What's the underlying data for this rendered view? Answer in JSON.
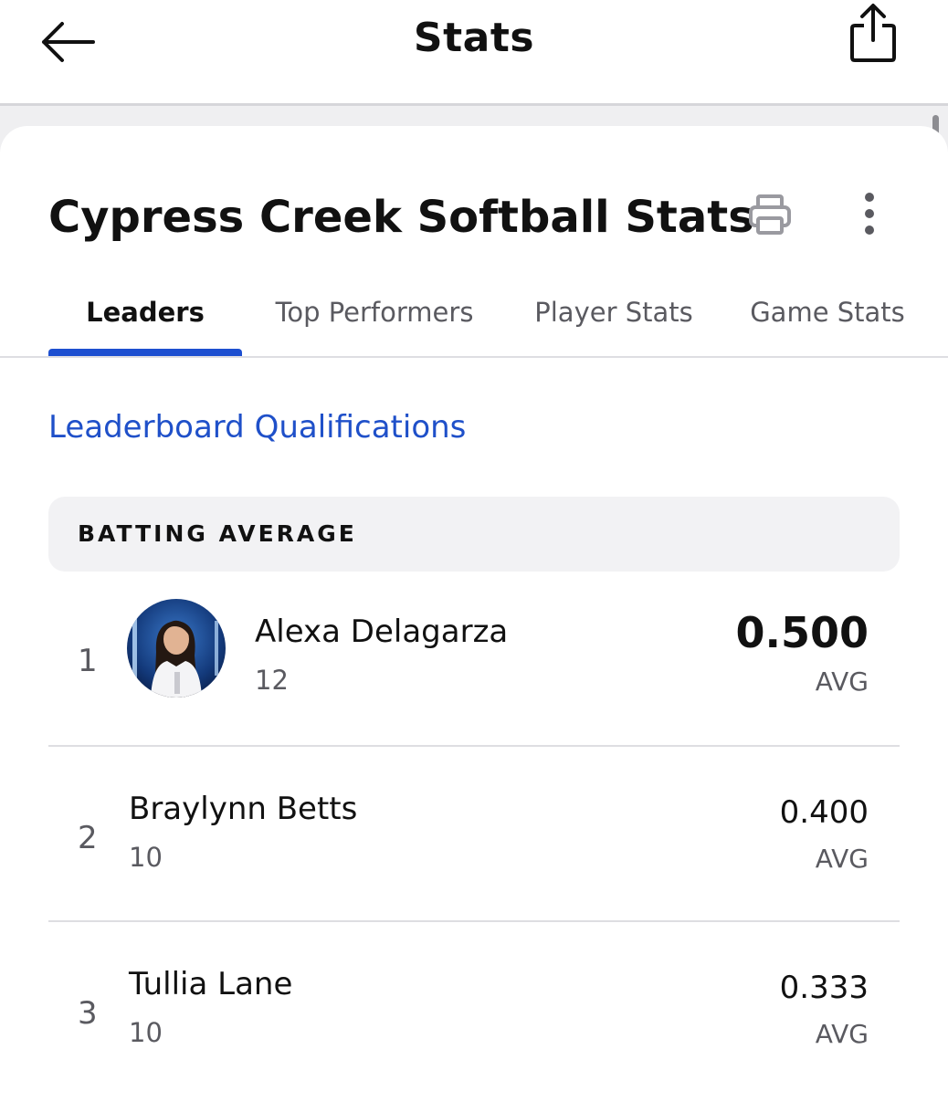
{
  "header": {
    "title": "Stats"
  },
  "card": {
    "title": "Cypress Creek Softball Stats",
    "tabs": [
      {
        "label": "Leaders",
        "active": true
      },
      {
        "label": "Top Performers",
        "active": false
      },
      {
        "label": "Player Stats",
        "active": false
      },
      {
        "label": "Game Stats",
        "active": false
      }
    ],
    "link": "Leaderboard Qualifications"
  },
  "leaderboard": {
    "section_title": "BATTING AVERAGE",
    "rows": [
      {
        "rank": "1",
        "name": "Alexa Delagarza",
        "number": "12",
        "value": "0.500",
        "unit": "AVG"
      },
      {
        "rank": "2",
        "name": "Braylynn Betts",
        "number": "10",
        "value": "0.400",
        "unit": "AVG"
      },
      {
        "rank": "3",
        "name": "Tullia Lane",
        "number": "10",
        "value": "0.333",
        "unit": "AVG"
      }
    ]
  },
  "colors": {
    "accent": "#1d4fd0",
    "link": "#1f50c9"
  },
  "icons": [
    "back-arrow-icon",
    "share-icon",
    "print-icon",
    "more-vertical-icon"
  ]
}
